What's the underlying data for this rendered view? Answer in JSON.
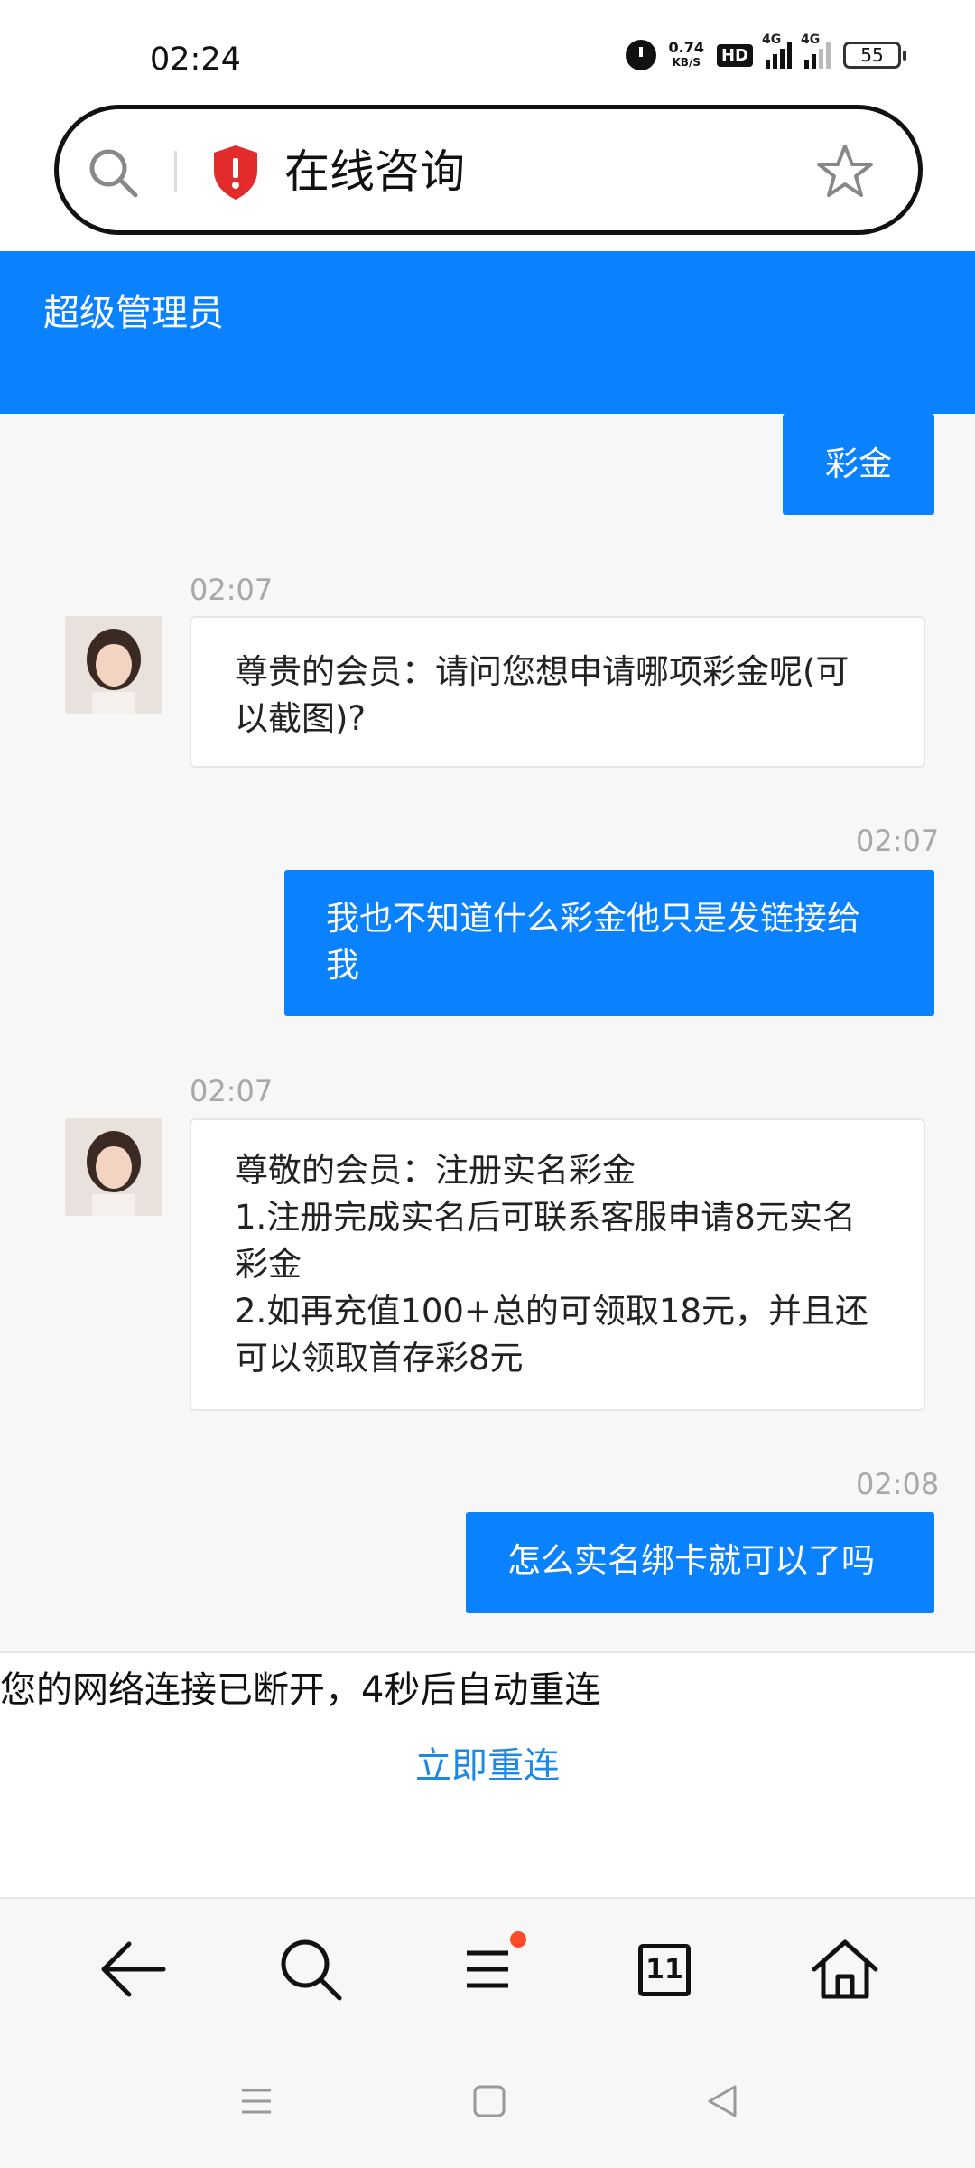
{
  "status_bar": {
    "time": "02:24",
    "net_speed_value": "0.74",
    "net_speed_unit": "KB/S",
    "hd_label": "HD",
    "signal_1_label": "4G",
    "signal_2_label": "4G",
    "battery": "55"
  },
  "address_bar": {
    "title": "在线咨询",
    "icons": [
      "search-icon",
      "shield-warning-icon",
      "star-icon"
    ]
  },
  "header": {
    "title": "超级管理员"
  },
  "chat": {
    "messages": [
      {
        "direction": "out",
        "text": "彩金"
      },
      {
        "direction": "in",
        "time": "02:07",
        "text": "尊贵的会员：请问您想申请哪项彩金呢(可以截图)?"
      },
      {
        "direction": "out",
        "time": "02:07",
        "text": "我也不知道什么彩金他只是发链接给我"
      },
      {
        "direction": "in",
        "time": "02:07",
        "lines": [
          "尊敬的会员：注册实名彩金",
          "1.注册完成实名后可联系客服申请8元实名彩金",
          "2.如再充值100+总的可领取18元，并且还可以领取首存彩8元"
        ]
      },
      {
        "direction": "out",
        "time": "02:08",
        "text": "怎么实名绑卡就可以了吗"
      }
    ]
  },
  "network": {
    "message": "您的网络连接已断开，4秒后自动重连",
    "reconnect_label": "立即重连"
  },
  "toolbar": {
    "tab_count": "11",
    "icons": [
      "back-arrow-icon",
      "search-icon",
      "menu-icon",
      "tabs-icon",
      "home-icon"
    ],
    "menu_badge_color": "#ff4a2a"
  },
  "colors": {
    "accent": "#0a82ff",
    "link": "#1e88e5"
  }
}
